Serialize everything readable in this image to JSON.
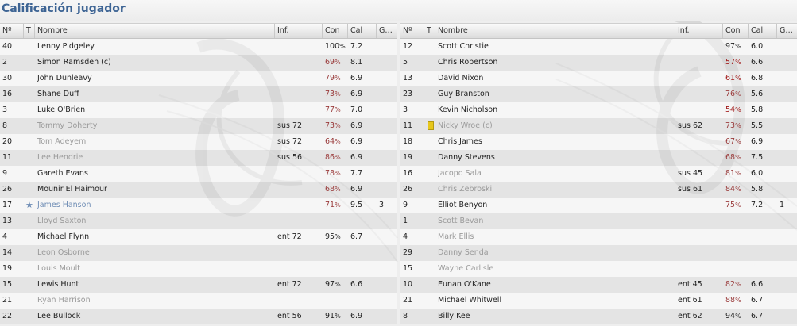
{
  "title": "Calificación jugador",
  "headers": {
    "num": "Nº",
    "t": "T",
    "name": "Nombre",
    "inf": "Inf.",
    "con": "Con",
    "cal": "Cal",
    "g": "G…"
  },
  "left": [
    {
      "num": "40",
      "name": "Lenny Pidgeley",
      "inf": "",
      "con": "100",
      "cal": "7.2",
      "g": "",
      "style": "normal",
      "con_style": "normal",
      "icon": ""
    },
    {
      "num": "2",
      "name": "Simon Ramsden (c)",
      "inf": "",
      "con": "69",
      "cal": "8.1",
      "g": "",
      "style": "normal",
      "con_style": "warn",
      "icon": ""
    },
    {
      "num": "30",
      "name": "John Dunleavy",
      "inf": "",
      "con": "79",
      "cal": "6.9",
      "g": "",
      "style": "normal",
      "con_style": "warn",
      "icon": ""
    },
    {
      "num": "16",
      "name": "Shane Duff",
      "inf": "",
      "con": "73",
      "cal": "6.9",
      "g": "",
      "style": "normal",
      "con_style": "warn",
      "icon": ""
    },
    {
      "num": "3",
      "name": "Luke O'Brien",
      "inf": "",
      "con": "77",
      "cal": "7.0",
      "g": "",
      "style": "normal",
      "con_style": "warn",
      "icon": ""
    },
    {
      "num": "8",
      "name": "Tommy Doherty",
      "inf": "sus 72",
      "con": "73",
      "cal": "6.9",
      "g": "",
      "style": "muted",
      "con_style": "warn",
      "icon": ""
    },
    {
      "num": "20",
      "name": "Tom Adeyemi",
      "inf": "sus 72",
      "con": "64",
      "cal": "6.9",
      "g": "",
      "style": "muted",
      "con_style": "warn",
      "icon": ""
    },
    {
      "num": "11",
      "name": "Lee Hendrie",
      "inf": "sus 56",
      "con": "86",
      "cal": "6.9",
      "g": "",
      "style": "muted",
      "con_style": "warn",
      "icon": ""
    },
    {
      "num": "9",
      "name": "Gareth Evans",
      "inf": "",
      "con": "78",
      "cal": "7.7",
      "g": "",
      "style": "normal",
      "con_style": "warn",
      "icon": ""
    },
    {
      "num": "26",
      "name": "Mounir El Haimour",
      "inf": "",
      "con": "68",
      "cal": "6.9",
      "g": "",
      "style": "normal",
      "con_style": "warn",
      "icon": ""
    },
    {
      "num": "17",
      "name": "James Hanson",
      "inf": "",
      "con": "71",
      "cal": "9.5",
      "g": "3",
      "style": "named",
      "con_style": "warn",
      "icon": "star"
    },
    {
      "num": "13",
      "name": "Lloyd Saxton",
      "inf": "",
      "con": "",
      "cal": "",
      "g": "",
      "style": "muted",
      "con_style": "normal",
      "icon": ""
    },
    {
      "num": "4",
      "name": "Michael Flynn",
      "inf": "ent 72",
      "con": "95",
      "cal": "6.7",
      "g": "",
      "style": "normal",
      "con_style": "normal",
      "icon": ""
    },
    {
      "num": "14",
      "name": "Leon Osborne",
      "inf": "",
      "con": "",
      "cal": "",
      "g": "",
      "style": "muted",
      "con_style": "normal",
      "icon": ""
    },
    {
      "num": "19",
      "name": "Louis Moult",
      "inf": "",
      "con": "",
      "cal": "",
      "g": "",
      "style": "muted",
      "con_style": "normal",
      "icon": ""
    },
    {
      "num": "15",
      "name": "Lewis Hunt",
      "inf": "ent 72",
      "con": "97",
      "cal": "6.6",
      "g": "",
      "style": "normal",
      "con_style": "normal",
      "icon": ""
    },
    {
      "num": "21",
      "name": "Ryan Harrison",
      "inf": "",
      "con": "",
      "cal": "",
      "g": "",
      "style": "muted",
      "con_style": "normal",
      "icon": ""
    },
    {
      "num": "22",
      "name": "Lee Bullock",
      "inf": "ent 56",
      "con": "91",
      "cal": "6.9",
      "g": "",
      "style": "normal",
      "con_style": "normal",
      "icon": ""
    }
  ],
  "right": [
    {
      "num": "12",
      "name": "Scott Christie",
      "inf": "",
      "con": "97",
      "cal": "6.0",
      "g": "",
      "style": "normal",
      "con_style": "normal",
      "icon": ""
    },
    {
      "num": "5",
      "name": "Chris Robertson",
      "inf": "",
      "con": "57",
      "cal": "6.6",
      "g": "",
      "style": "normal",
      "con_style": "bad",
      "icon": ""
    },
    {
      "num": "13",
      "name": "David Nixon",
      "inf": "",
      "con": "61",
      "cal": "6.8",
      "g": "",
      "style": "normal",
      "con_style": "bad",
      "icon": ""
    },
    {
      "num": "23",
      "name": "Guy Branston",
      "inf": "",
      "con": "76",
      "cal": "5.6",
      "g": "",
      "style": "normal",
      "con_style": "warn",
      "icon": ""
    },
    {
      "num": "3",
      "name": "Kevin Nicholson",
      "inf": "",
      "con": "54",
      "cal": "5.8",
      "g": "",
      "style": "normal",
      "con_style": "bad",
      "icon": ""
    },
    {
      "num": "11",
      "name": "Nicky Wroe (c)",
      "inf": "sus 62",
      "con": "73",
      "cal": "5.5",
      "g": "",
      "style": "muted",
      "con_style": "warn",
      "icon": "yellow-card"
    },
    {
      "num": "18",
      "name": "Chris James",
      "inf": "",
      "con": "67",
      "cal": "6.9",
      "g": "",
      "style": "normal",
      "con_style": "warn",
      "icon": ""
    },
    {
      "num": "19",
      "name": "Danny Stevens",
      "inf": "",
      "con": "68",
      "cal": "7.5",
      "g": "",
      "style": "normal",
      "con_style": "warn",
      "icon": ""
    },
    {
      "num": "16",
      "name": "Jacopo Sala",
      "inf": "sus 45",
      "con": "81",
      "cal": "6.0",
      "g": "",
      "style": "muted",
      "con_style": "warn",
      "icon": ""
    },
    {
      "num": "26",
      "name": "Chris Zebroski",
      "inf": "sus 61",
      "con": "84",
      "cal": "5.8",
      "g": "",
      "style": "muted",
      "con_style": "warn",
      "icon": ""
    },
    {
      "num": "9",
      "name": "Elliot Benyon",
      "inf": "",
      "con": "75",
      "cal": "7.2",
      "g": "1",
      "style": "normal",
      "con_style": "warn",
      "icon": ""
    },
    {
      "num": "1",
      "name": "Scott Bevan",
      "inf": "",
      "con": "",
      "cal": "",
      "g": "",
      "style": "muted",
      "con_style": "normal",
      "icon": ""
    },
    {
      "num": "4",
      "name": "Mark Ellis",
      "inf": "",
      "con": "",
      "cal": "",
      "g": "",
      "style": "muted",
      "con_style": "normal",
      "icon": ""
    },
    {
      "num": "29",
      "name": "Danny Senda",
      "inf": "",
      "con": "",
      "cal": "",
      "g": "",
      "style": "muted",
      "con_style": "normal",
      "icon": ""
    },
    {
      "num": "15",
      "name": "Wayne Carlisle",
      "inf": "",
      "con": "",
      "cal": "",
      "g": "",
      "style": "muted",
      "con_style": "normal",
      "icon": ""
    },
    {
      "num": "10",
      "name": "Eunan O'Kane",
      "inf": "ent 45",
      "con": "82",
      "cal": "6.6",
      "g": "",
      "style": "normal",
      "con_style": "warn",
      "icon": ""
    },
    {
      "num": "21",
      "name": "Michael Whitwell",
      "inf": "ent 61",
      "con": "88",
      "cal": "6.7",
      "g": "",
      "style": "normal",
      "con_style": "warn",
      "icon": ""
    },
    {
      "num": "8",
      "name": "Billy Kee",
      "inf": "ent 62",
      "con": "94",
      "cal": "6.7",
      "g": "",
      "style": "normal",
      "con_style": "normal",
      "icon": ""
    }
  ]
}
